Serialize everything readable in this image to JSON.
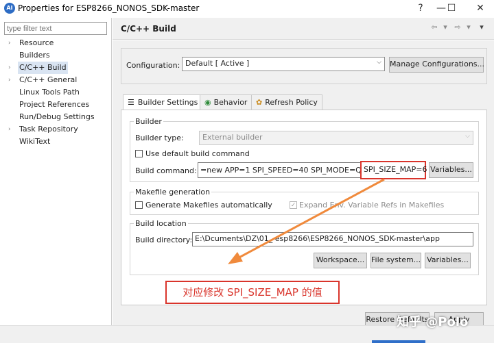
{
  "window": {
    "title": "Properties for ESP8266_NONOS_SDK-master",
    "controls": {
      "help": "?",
      "minimize": "—",
      "maximize": "☐",
      "close": "✕"
    }
  },
  "sidebar": {
    "filter_placeholder": "type filter text",
    "items": [
      {
        "label": "Resource",
        "caret": "›"
      },
      {
        "label": "Builders",
        "caret": ""
      },
      {
        "label": "C/C++ Build",
        "caret": "›"
      },
      {
        "label": "C/C++ General",
        "caret": "›"
      },
      {
        "label": "Linux Tools Path",
        "caret": ""
      },
      {
        "label": "Project References",
        "caret": ""
      },
      {
        "label": "Run/Debug Settings",
        "caret": ""
      },
      {
        "label": "Task Repository",
        "caret": "›"
      },
      {
        "label": "WikiText",
        "caret": ""
      }
    ]
  },
  "header": {
    "title": "C/C++ Build",
    "nav": {
      "back": "⇦",
      "back_menu": "▾",
      "forward": "⇨",
      "forward_menu": "▾",
      "menu": "▾"
    }
  },
  "configuration": {
    "label": "Configuration:",
    "value": "Default  [ Active ]",
    "manage_button": "Manage Configurations..."
  },
  "tabs": [
    {
      "label": "Builder Settings"
    },
    {
      "label": "Behavior"
    },
    {
      "label": "Refresh Policy"
    }
  ],
  "builder": {
    "group_label": "Builder",
    "type_label": "Builder type:",
    "type_value": "External builder",
    "use_default_label": "Use default build command",
    "command_label": "Build command:",
    "command_value": "=new APP=1 SPI_SPEED=40 SPI_MODE=QIO",
    "command_highlight": "SPI_SIZE_MAP=6",
    "variables_button": "Variables..."
  },
  "makefile": {
    "group_label": "Makefile generation",
    "generate_label": "Generate Makefiles automatically",
    "expand_label": "Expand Env. Variable Refs in Makefiles"
  },
  "location": {
    "group_label": "Build location",
    "dir_label": "Build directory:",
    "dir_value": "E:\\Dcuments\\DZ\\01_   esp8266\\ESP8266_NONOS_SDK-master\\app",
    "workspace_button": "Workspace...",
    "filesystem_button": "File system...",
    "variables_button": "Variables..."
  },
  "annotation": {
    "text": "对应修改 SPI_SIZE_MAP 的值"
  },
  "footer": {
    "restore_button": "Restore Defaults",
    "apply_button": "Apply"
  },
  "watermark": "知乎 @Polo",
  "colors": {
    "highlight_red": "#d9342b",
    "arrow_orange": "#f08a3c",
    "selection": "#d9e4f2"
  }
}
